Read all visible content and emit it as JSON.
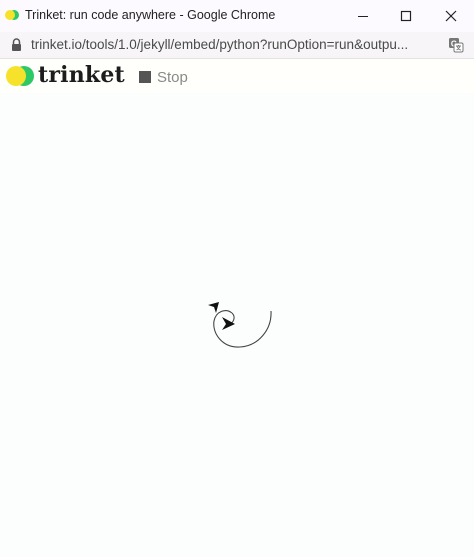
{
  "window": {
    "title": "Trinket: run code anywhere - Google Chrome",
    "favicon": "trinket-favicon",
    "controls": [
      "minimize-icon",
      "maximize-icon",
      "close-icon"
    ]
  },
  "addressbar": {
    "url": "trinket.io/tools/1.0/jekyll/embed/python?runOption=run&outpu...",
    "lock_icon": "lock-icon",
    "translate_icon": "translate-icon"
  },
  "trinket": {
    "logo_text": "trinket",
    "stop_label": "Stop",
    "colors": {
      "logo_green": "#2ec866",
      "logo_yellow": "#f6e22b",
      "stop_gray": "#555555"
    }
  },
  "canvas": {
    "background": "#fbfefd",
    "turtle_icon": "turtle-arrow-icon"
  }
}
